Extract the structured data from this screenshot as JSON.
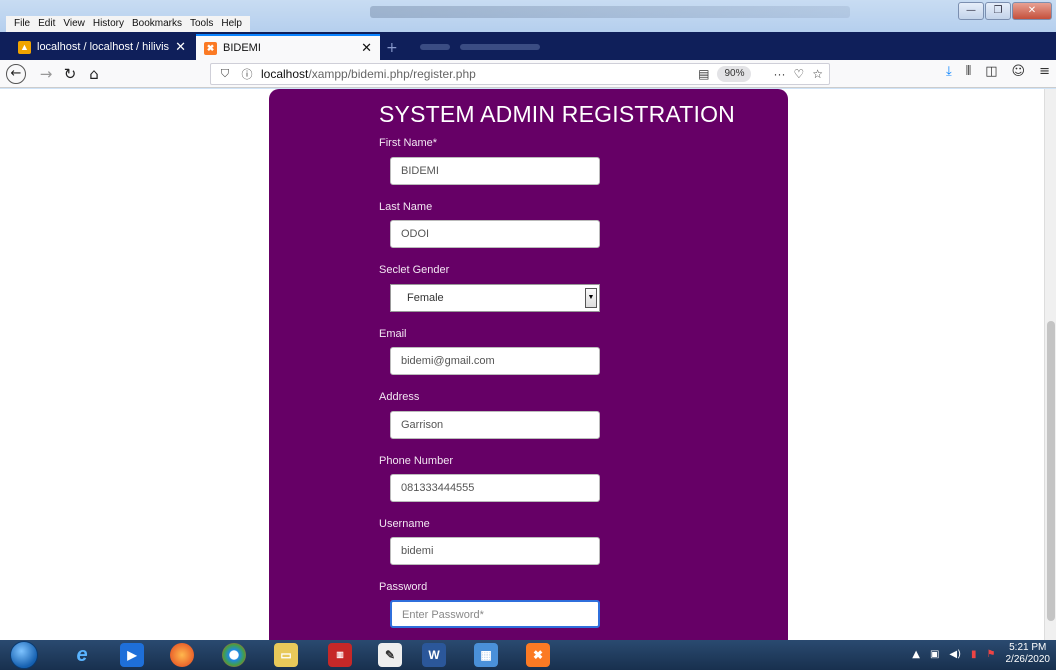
{
  "menu": [
    "File",
    "Edit",
    "View",
    "History",
    "Bookmarks",
    "Tools",
    "Help"
  ],
  "tabs": [
    {
      "label": "localhost / localhost / hilivis / ...",
      "icon": "phpmyadmin-icon"
    },
    {
      "label": "BIDEMI",
      "icon": "xampp-icon",
      "close": "✕"
    }
  ],
  "url": {
    "host": "localhost",
    "path": "/xampp/bidemi.php/register.php"
  },
  "zoom": "90%",
  "form": {
    "title": "SYSTEM ADMIN REGISTRATION",
    "fields": [
      {
        "label": "First Name*",
        "value": "BIDEMI"
      },
      {
        "label": "Last Name",
        "value": "ODOI"
      },
      {
        "label": "Seclet Gender",
        "value": "Female"
      },
      {
        "label": "Email",
        "value": "bidemi@gmail.com"
      },
      {
        "label": "Address",
        "value": "Garrison"
      },
      {
        "label": "Phone Number",
        "value": "081333444555"
      },
      {
        "label": "Username",
        "value": "bidemi"
      },
      {
        "label": "Password",
        "placeholder": "Enter Password*"
      }
    ]
  },
  "clock": {
    "time": "5:21 PM",
    "date": "2/26/2020"
  },
  "colors": {
    "panel": "#660066",
    "tabbar": "#0f1f5a",
    "accent": "#0a84ff"
  }
}
